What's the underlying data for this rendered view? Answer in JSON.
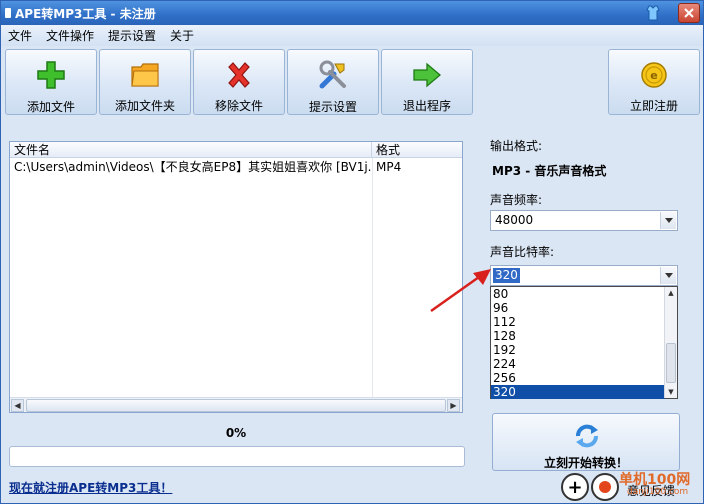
{
  "window": {
    "title": "APE转MP3工具 - 未注册"
  },
  "menu": [
    "文件",
    "文件操作",
    "提示设置",
    "关于"
  ],
  "toolbar": {
    "add_file": "添加文件",
    "add_folder": "添加文件夹",
    "remove_file": "移除文件",
    "settings": "提示设置",
    "exit": "退出程序",
    "register": "立即注册"
  },
  "filelist": {
    "columns": {
      "name": "文件名",
      "format": "格式"
    },
    "rows": [
      {
        "name": "C:\\Users\\admin\\Videos\\【不良女高EP8】其实姐姐喜欢你 [BV1j...",
        "format": "MP4"
      }
    ]
  },
  "progress": {
    "label": "0%",
    "value": 0
  },
  "register_link": "现在就注册APE转MP3工具！",
  "output": {
    "format_label": "输出格式:",
    "format_value": "MP3 - 音乐声音格式",
    "freq_label": "声音频率:",
    "freq_value": "48000",
    "bitrate_label": "声音比特率:",
    "bitrate_value": "320",
    "bitrate_options": [
      "80",
      "96",
      "112",
      "128",
      "192",
      "224",
      "256",
      "320"
    ],
    "bitrate_selected": "320"
  },
  "convert": {
    "label": "立刻开始转换！"
  },
  "feedback": {
    "plus": "+",
    "label": "意见反馈"
  },
  "watermark": {
    "main": "单机100网",
    "sub": "danji100.com"
  },
  "colors": {
    "accent": "#2f6fc8",
    "selection": "#0f4fa8",
    "link": "#0a2f8f"
  }
}
